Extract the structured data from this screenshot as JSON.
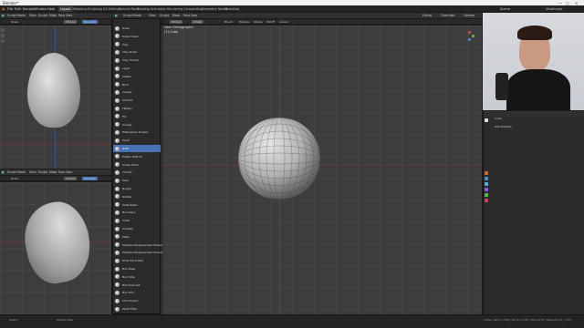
{
  "titlebar": {
    "title": "Blender*"
  },
  "menubar": {
    "menus": [
      "File",
      "Edit",
      "Render",
      "Window",
      "Help"
    ],
    "tabs": [
      "Layout",
      "Modeling",
      "Sculpting",
      "UV Editing",
      "Texture Paint",
      "Shading",
      "Animation",
      "Rendering",
      "Compositing",
      "Geometry Nodes",
      "Scripting"
    ],
    "active_tab": "Layout",
    "scene": "Scene",
    "view_layer": "ViewLayer"
  },
  "left_top_editor": {
    "mode": "Sculpt Mode",
    "menus": [
      "View",
      "Sculpt",
      "Mask",
      "Face Sets"
    ],
    "brush": "Draw",
    "radius": "154 px",
    "strength": "Strength"
  },
  "left_bottom_editor": {
    "mode": "Sculpt Mode",
    "menus": [
      "View",
      "Sculpt",
      "Mask",
      "Face Sets"
    ],
    "brush": "Draw",
    "radius": "154 px",
    "strength": "Strength"
  },
  "main_editor": {
    "mode": "Sculpt Mode",
    "menus": [
      "View",
      "Sculpt",
      "Mask",
      "Face Sets"
    ],
    "brush": "Draw",
    "radius": "154 px",
    "strength": "0.500",
    "right_menus": [
      "Brush",
      "Texture",
      "Stroke",
      "Falloff",
      "Cursor"
    ],
    "overlay_buttons": [
      "Extras",
      "Overrides",
      "Options"
    ],
    "view_label": "User Orthographic",
    "object_label": "(1) Cube"
  },
  "brush_menu": {
    "items": [
      "Draw",
      "Draw Sharp",
      "Clay",
      "Clay Strips",
      "Clay Thumb",
      "Layer",
      "Inflate",
      "Blob",
      "Crease",
      "Smooth",
      "Flatten",
      "Fill",
      "Scrape",
      "Multi-plane Scrape",
      "Pinch",
      "Grab",
      "Elastic Deform",
      "Snake Hook",
      "Thumb",
      "Pose",
      "Nudge",
      "Rotate",
      "Slide Relax",
      "Boundary",
      "Cloth",
      "Simplify",
      "Mask",
      "Multires Displacement Eraser",
      "Multires Displacement Smear",
      "Draw Face Sets",
      "Box Mask",
      "Box Hide",
      "Box Face Set",
      "Box Trim",
      "Line Project",
      "Mesh Filter"
    ],
    "selected": "Grab"
  },
  "properties": {
    "object_name": "Cube",
    "section": "Add Modifier"
  },
  "statusbar": {
    "left_hint": "Select",
    "middle_hint": "Rotate View",
    "right_info": "Cube | Verts 1,538 | Faces 1,536 | Tris 3,072 | Objects 1/1 | 3.3.1"
  },
  "colors": {
    "accent": "#4772b3",
    "viewport": "#3d3d3d",
    "header": "#303030",
    "x_axis": "#8a3b3b",
    "y_axis": "#3b5f8a"
  }
}
